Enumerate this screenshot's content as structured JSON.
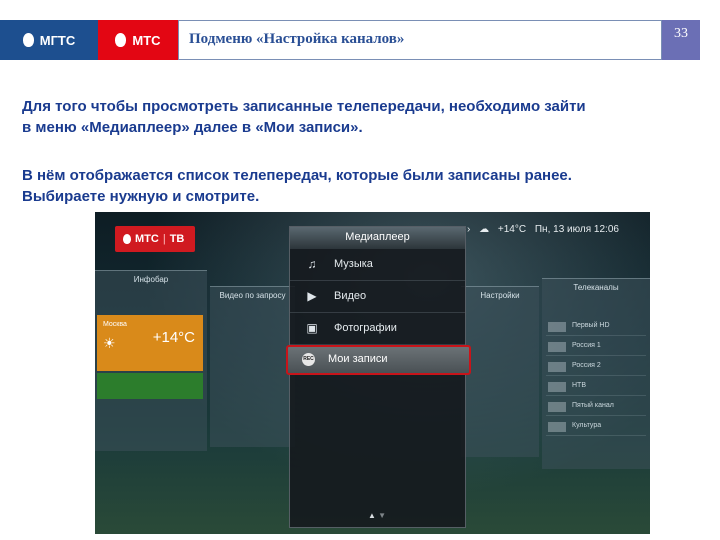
{
  "header": {
    "logo_mgts": "МГТС",
    "logo_mts": "МТС",
    "title": "Подменю «Настройка каналов»",
    "page_number": "33",
    "colors": {
      "mgts": "#1d4f8f",
      "mts": "#e30613",
      "title_text": "#2a4f95",
      "page_box": "#6b6fb5"
    }
  },
  "body": {
    "paragraph1_line1": "Для того чтобы просмотреть записанные телепередачи, необходимо зайти",
    "paragraph1_line2": "в меню «Медиаплеер» далее в «Мои записи».",
    "paragraph2_line1": "В нём отображается список телепередач, которые были записаны ранее.",
    "paragraph2_line2": "Выбираете нужную и смотрите."
  },
  "tv": {
    "badge_brand": "МТС",
    "badge_tv": "ТВ",
    "status": {
      "weather": "+14°C",
      "date_time": "Пн, 13 июля 12:06"
    },
    "infobar": {
      "title": "Инфобар",
      "city": "Москва",
      "temp": "+14°C"
    },
    "video_panel_title": "Видео по запросу",
    "settings_panel_title": "Настройки",
    "channels_panel": {
      "title": "Телеканалы",
      "rows": [
        "Первый HD",
        "Россия 1",
        "Россия 2",
        "НТВ",
        "Пятый канал",
        "Культура"
      ]
    },
    "menu": {
      "title": "Медиаплеер",
      "items": [
        {
          "label": "Музыка",
          "icon": "music-icon"
        },
        {
          "label": "Видео",
          "icon": "play-icon"
        },
        {
          "label": "Фотографии",
          "icon": "photo-icon"
        },
        {
          "label": "Мои записи",
          "icon": "rec-icon",
          "selected": true
        }
      ],
      "selected_border": "#c8141a"
    }
  }
}
